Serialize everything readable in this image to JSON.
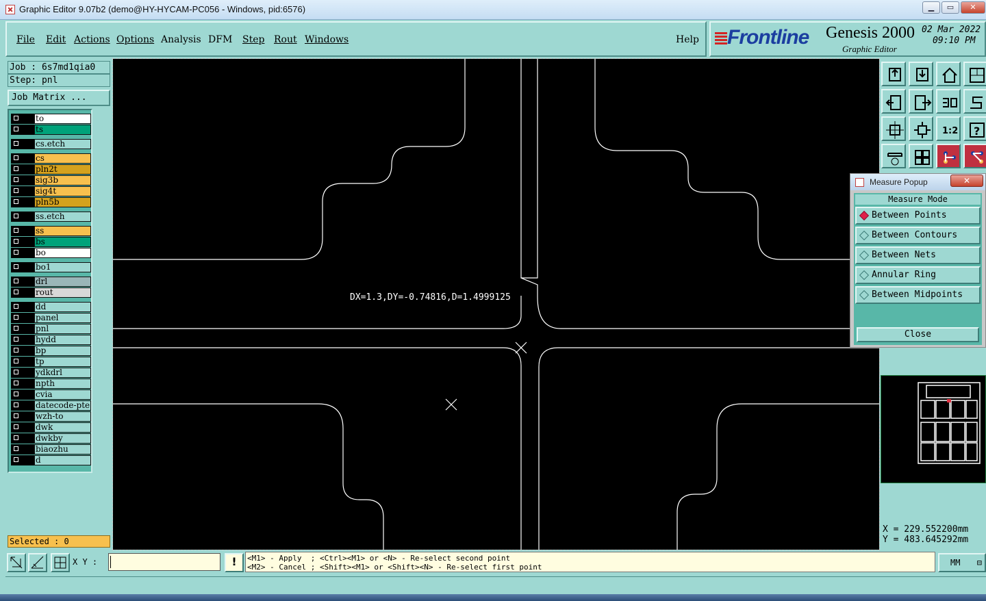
{
  "window": {
    "title": "Graphic Editor 9.07b2 (demo@HY-HYCAM-PC056 - Windows, pid:6576)",
    "buttons": [
      "minimize",
      "maximize",
      "close"
    ]
  },
  "menu": {
    "file": "File",
    "edit": "Edit",
    "actions": "Actions",
    "options": "Options",
    "analysis": "Analysis",
    "dfm": "DFM",
    "step": "Step",
    "rout": "Rout",
    "windows": "Windows",
    "help": "Help"
  },
  "brand": {
    "logo": "Frontline",
    "product": "Genesis 2000",
    "subtitle": "Graphic Editor",
    "date": "02 Mar 2022",
    "time": "09:10 PM"
  },
  "job": {
    "job_label": "Job : 6s7md1qia0",
    "step_label": "Step: pnl",
    "matrix_button": "Job Matrix ..."
  },
  "layers": [
    {
      "name": "to",
      "color": "#ffffff"
    },
    {
      "name": "ts",
      "color": "#00a27a"
    },
    {
      "name": "cs.etch",
      "color": "#9ed8d2"
    },
    {
      "name": "cs",
      "color": "#f7c04e"
    },
    {
      "name": "pln2t",
      "color": "#d4a21e"
    },
    {
      "name": "sig3b",
      "color": "#f7c04e"
    },
    {
      "name": "sig4t",
      "color": "#f7c04e"
    },
    {
      "name": "pln5b",
      "color": "#d4a21e"
    },
    {
      "name": "ss.etch",
      "color": "#9ed8d2"
    },
    {
      "name": "ss",
      "color": "#f7c04e"
    },
    {
      "name": "bs",
      "color": "#00a27a"
    },
    {
      "name": "bo",
      "color": "#ffffff"
    },
    {
      "name": "bo1",
      "color": "#9ed8d2"
    },
    {
      "name": "drl",
      "color": "#9ab6b8"
    },
    {
      "name": "rout",
      "color": "#d8d8d8"
    },
    {
      "name": "dd",
      "color": "#9ed8d2"
    },
    {
      "name": "panel",
      "color": "#9ed8d2"
    },
    {
      "name": "pnl",
      "color": "#9ed8d2"
    },
    {
      "name": "hydd",
      "color": "#9ed8d2"
    },
    {
      "name": "bp",
      "color": "#9ed8d2"
    },
    {
      "name": "tp",
      "color": "#9ed8d2"
    },
    {
      "name": "ydkdrl",
      "color": "#9ed8d2"
    },
    {
      "name": "npth",
      "color": "#9ed8d2"
    },
    {
      "name": "cvia",
      "color": "#9ed8d2"
    },
    {
      "name": "datecode-pte",
      "color": "#9ed8d2"
    },
    {
      "name": "wzh-to",
      "color": "#9ed8d2"
    },
    {
      "name": "dwk",
      "color": "#9ed8d2"
    },
    {
      "name": "dwkby",
      "color": "#9ed8d2"
    },
    {
      "name": "biaozhu",
      "color": "#9ed8d2"
    },
    {
      "name": "d",
      "color": "#9ed8d2"
    }
  ],
  "selected_label": "Selected : 0",
  "canvas": {
    "measurement": "DX=1.3,DY=-0.74816,D=1.4999125"
  },
  "measure_popup": {
    "title": "Measure Popup",
    "close_x": "✕",
    "mode_header": "Measure Mode",
    "options": [
      "Between Points",
      "Between Contours",
      "Between Nets",
      "Annular Ring",
      "Between Midpoints"
    ],
    "selected_option": "Between Points",
    "close_button": "Close"
  },
  "coordinates": {
    "x": "X = 229.552200mm",
    "y": "Y = 483.645292mm"
  },
  "bottom": {
    "xy_label": "X Y :",
    "xy_value": "",
    "warn": "!",
    "help_line1": "<M1> - Apply  ; <Ctrl><M1> or <N> - Re-select second point",
    "help_line2": "<M2> - Cancel ; <Shift><M1> or <Shift><N> - Re-select first point",
    "units": "MM"
  },
  "toolbar_icons": [
    "layer-up-icon",
    "layer-down-icon",
    "home-icon",
    "window-icon",
    "undo-icon",
    "redo-icon",
    "snap-icon",
    "snap-alt-icon",
    "fit-icon",
    "zoom-center-icon",
    "scale-icon",
    "help-icon",
    "toolbox-icon",
    "grid-icon",
    "net-icon",
    "net-alt-icon"
  ]
}
